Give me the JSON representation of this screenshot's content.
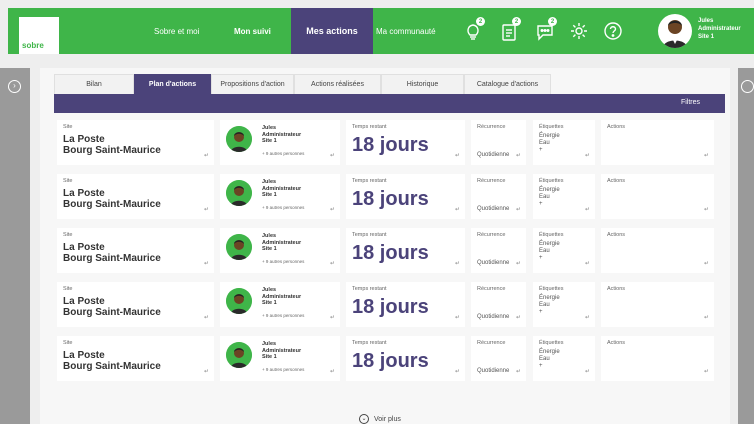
{
  "brand": {
    "logo_text": "sobre",
    "green": "#3fb549",
    "purple": "#4b437a"
  },
  "nav": {
    "items": [
      {
        "label": "Sobre et moi"
      },
      {
        "label": "Mon suivi"
      },
      {
        "label": "Mes actions"
      },
      {
        "label": "Ma communauté"
      }
    ],
    "icons": [
      {
        "name": "lightbulb-icon",
        "badge": "2"
      },
      {
        "name": "clipboard-icon",
        "badge": "2"
      },
      {
        "name": "chat-icon",
        "badge": "2"
      },
      {
        "name": "gear-icon"
      },
      {
        "name": "help-icon"
      }
    ],
    "user": {
      "name": "Jules",
      "role": "Administrateur",
      "site": "Site 1"
    }
  },
  "tabs": [
    {
      "label": "Bilan"
    },
    {
      "label": "Plan d'actions"
    },
    {
      "label": "Propositions d'action"
    },
    {
      "label": "Actions réalisées"
    },
    {
      "label": "Historique"
    },
    {
      "label": "Catalogue d'actions"
    }
  ],
  "filter_label": "Filtres",
  "rows": [
    {
      "site_label": "Site",
      "site_line1": "La Poste",
      "site_line2": "Bourg Saint-Maurice",
      "person_name": "Jules",
      "person_role": "Administrateur",
      "person_site": "Site 1",
      "person_more": "+ 9 autres personnes",
      "time_label": "Temps restant",
      "time_value": "18 jours",
      "rec_label": "Récurrence",
      "rec_value": "Quotidienne",
      "tags_label": "Étiquettes",
      "tag1": "Énergie",
      "tag2": "Eau",
      "tag_add": "+",
      "actions_label": "Actions"
    },
    {
      "site_label": "Site",
      "site_line1": "La Poste",
      "site_line2": "Bourg Saint-Maurice",
      "person_name": "Jules",
      "person_role": "Administrateur",
      "person_site": "Site 1",
      "person_more": "+ 9 autres personnes",
      "time_label": "Temps restant",
      "time_value": "18 jours",
      "rec_label": "Récurrence",
      "rec_value": "Quotidienne",
      "tags_label": "Étiquettes",
      "tag1": "Énergie",
      "tag2": "Eau",
      "tag_add": "+",
      "actions_label": "Actions"
    },
    {
      "site_label": "Site",
      "site_line1": "La Poste",
      "site_line2": "Bourg Saint-Maurice",
      "person_name": "Jules",
      "person_role": "Administrateur",
      "person_site": "Site 1",
      "person_more": "+ 9 autres personnes",
      "time_label": "Temps restant",
      "time_value": "18 jours",
      "rec_label": "Récurrence",
      "rec_value": "Quotidienne",
      "tags_label": "Étiquettes",
      "tag1": "Énergie",
      "tag2": "Eau",
      "tag_add": "+",
      "actions_label": "Actions"
    },
    {
      "site_label": "Site",
      "site_line1": "La Poste",
      "site_line2": "Bourg Saint-Maurice",
      "person_name": "Jules",
      "person_role": "Administrateur",
      "person_site": "Site 1",
      "person_more": "+ 9 autres personnes",
      "time_label": "Temps restant",
      "time_value": "18 jours",
      "rec_label": "Récurrence",
      "rec_value": "Quotidienne",
      "tags_label": "Étiquettes",
      "tag1": "Énergie",
      "tag2": "Eau",
      "tag_add": "+",
      "actions_label": "Actions"
    },
    {
      "site_label": "Site",
      "site_line1": "La Poste",
      "site_line2": "Bourg Saint-Maurice",
      "person_name": "Jules",
      "person_role": "Administrateur",
      "person_site": "Site 1",
      "person_more": "+ 9 autres personnes",
      "time_label": "Temps restant",
      "time_value": "18 jours",
      "rec_label": "Récurrence",
      "rec_value": "Quotidienne",
      "tags_label": "Étiquettes",
      "tag1": "Énergie",
      "tag2": "Eau",
      "tag_add": "+",
      "actions_label": "Actions"
    }
  ],
  "see_more": "Voir plus"
}
